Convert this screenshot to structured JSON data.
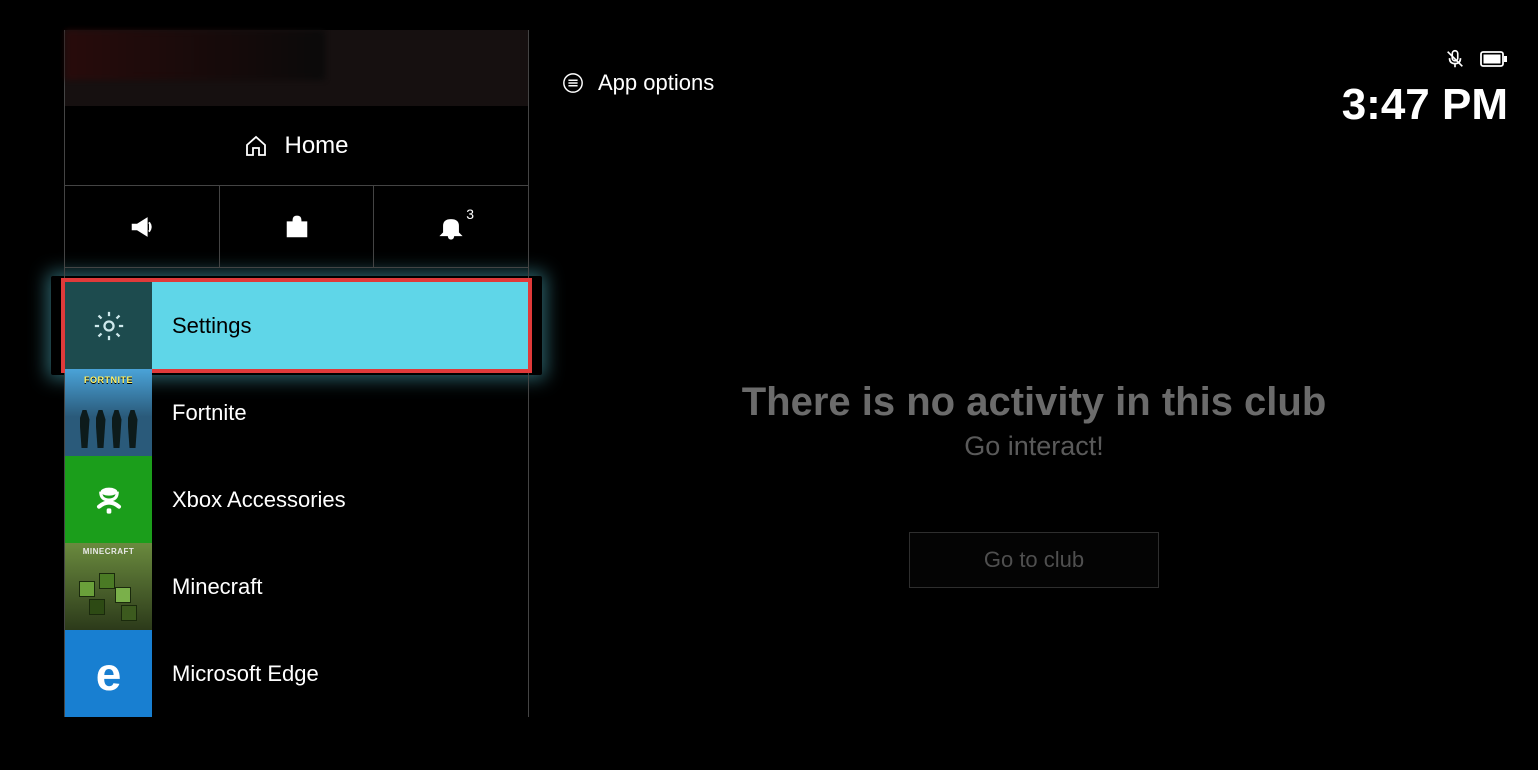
{
  "header": {
    "app_options_label": "App options",
    "clock": "3:47 PM"
  },
  "sidebar": {
    "home_label": "Home",
    "notification_count": "3",
    "items": [
      {
        "label": "Settings"
      },
      {
        "label": "Fortnite"
      },
      {
        "label": "Xbox Accessories"
      },
      {
        "label": "Minecraft"
      },
      {
        "label": "Microsoft Edge"
      }
    ]
  },
  "main": {
    "empty_title": "There is no activity in this club",
    "empty_sub": "Go interact!",
    "button_label": "Go to club"
  },
  "icons": {
    "edge_glyph": "e"
  }
}
